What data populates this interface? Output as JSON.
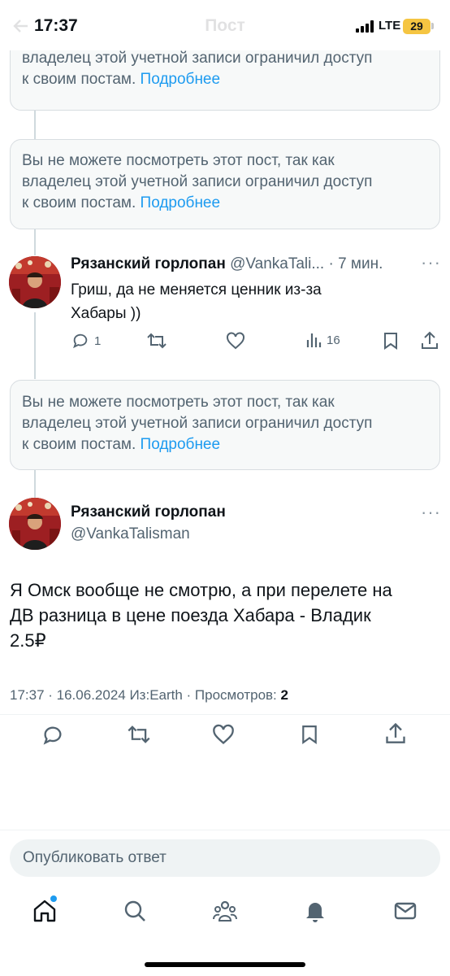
{
  "status_bar": {
    "time": "17:37",
    "header_title": "Пост",
    "network": "LTE",
    "battery": "29"
  },
  "notices": [
    {
      "line1": "",
      "line2": "владелец этой учетной записи ограничил доступ",
      "line3": "к своим постам.",
      "more": "Подробнее"
    },
    {
      "line1": "Вы не можете посмотреть этот пост, так как",
      "line2": "владелец этой учетной записи ограничил доступ",
      "line3": "к своим постам.",
      "more": "Подробнее"
    },
    {
      "line1": "Вы не можете посмотреть этот пост, так как",
      "line2": "владелец этой учетной записи ограничил доступ",
      "line3": "к своим постам.",
      "more": "Подробнее"
    }
  ],
  "reply": {
    "name": "Рязанский горлопан",
    "handle": "@VankaTali...",
    "time": "· 7 мин.",
    "text_line1": "Гриш, да не меняется ценник из-за",
    "text_line2": "Хабары ))",
    "replies": "1",
    "views": "16"
  },
  "main_post": {
    "name": "Рязанский горлопан",
    "handle": "@VankaTalisman",
    "text_line1": "Я Омск вообще не смотрю, а при перелете на",
    "text_line2": "ДВ разница в цене поезда Хабара - Владик",
    "text_line3": "2.5₽",
    "meta": "17:37 · 16.06.2024 Из:Earth · Просмотров: ",
    "views": "2"
  },
  "compose": {
    "placeholder": "Опубликовать ответ"
  },
  "tabbar": [
    "home-icon",
    "search-icon",
    "communities-icon",
    "notifications-icon",
    "messages-icon"
  ],
  "colors": {
    "accent": "#1d9bf0",
    "secondary_text": "#536471",
    "notice_bg": "#f7f9f9"
  }
}
